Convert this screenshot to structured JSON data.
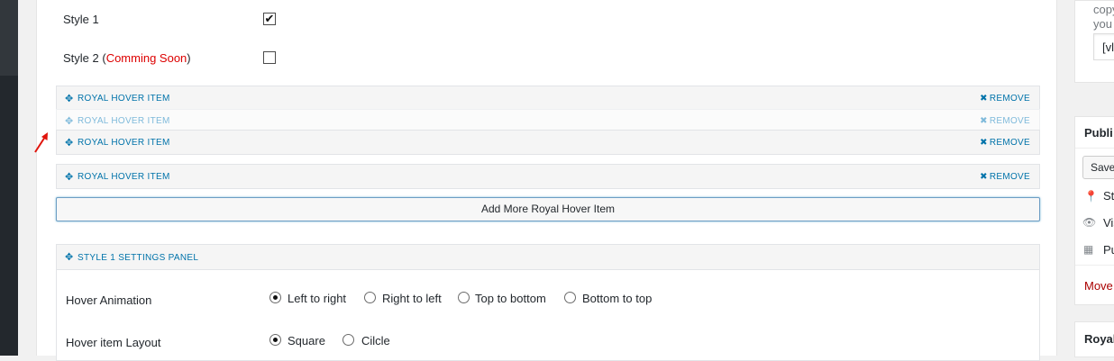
{
  "style_options": [
    {
      "label": "Style 1",
      "note": "",
      "checked": true
    },
    {
      "label": "Style 2 (",
      "note": "Comming Soon",
      "suffix": ")",
      "checked": false
    }
  ],
  "items": [
    {
      "title": "ROYAL HOVER ITEM",
      "remove": "REMOVE"
    },
    {
      "title": "ROYAL HOVER ITEM",
      "remove": "REMOVE"
    },
    {
      "title": "ROYAL HOVER ITEM",
      "remove": "REMOVE"
    },
    {
      "title": "ROYAL HOVER ITEM",
      "remove": "REMOVE"
    }
  ],
  "add_button": "Add More Royal Hover Item",
  "settings_panel": {
    "title": "STYLE 1 SETTINGS PANEL",
    "hover_animation": {
      "label": "Hover Animation",
      "options": [
        "Left to right",
        "Right to left",
        "Top to bottom",
        "Bottom to top"
      ],
      "selected": "Left to right"
    },
    "hover_layout": {
      "label": "Hover item Layout",
      "options": [
        "Square",
        "Cilcle"
      ],
      "selected": "Square"
    }
  },
  "sidebar": {
    "shortcode_box": {
      "line1": "copy",
      "line2": "you",
      "input_value": "[vl"
    },
    "publish_box": {
      "heading": "Publi",
      "save_button": "Save",
      "status_text": "St",
      "visibility_text": "Vis",
      "publish_text": "Pu",
      "move_link": "Move"
    },
    "royal_box": {
      "heading": "Royal"
    }
  },
  "colors": {
    "accent": "#0073aa",
    "warning": "#dd0000",
    "trash": "#a00"
  }
}
